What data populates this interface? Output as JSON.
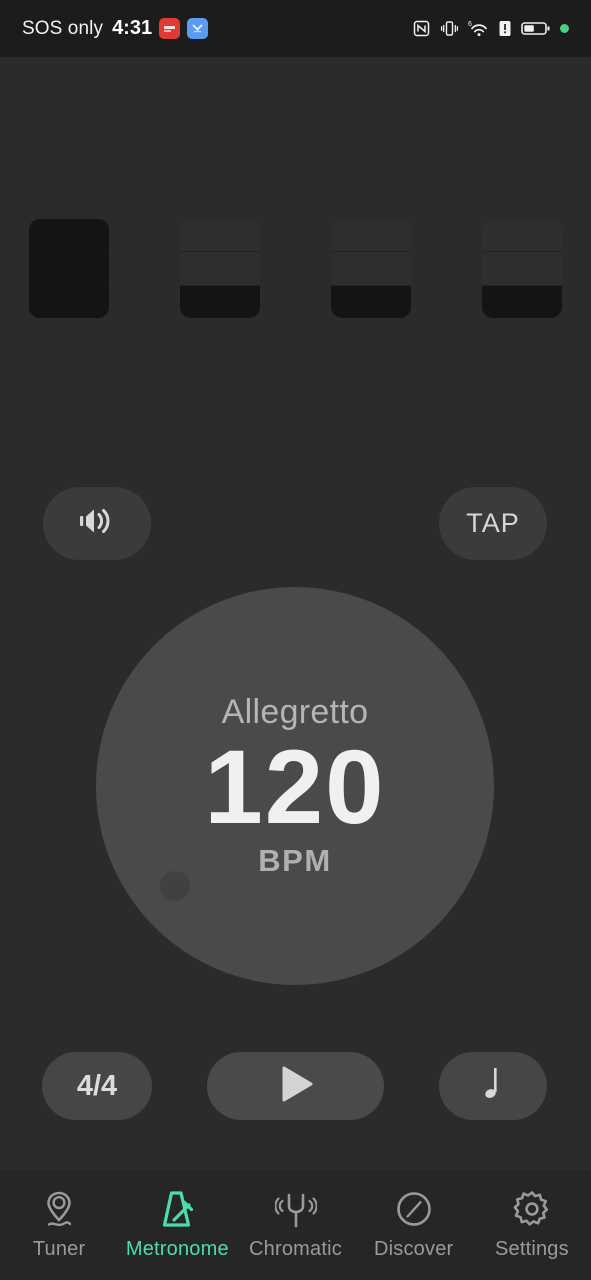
{
  "status_bar": {
    "carrier": "SOS only",
    "time": "4:31",
    "notification_icons": [
      {
        "name": "red-app-notification-icon",
        "color": "#e03a33"
      },
      {
        "name": "blue-app-notification-icon",
        "color": "#5b9bf0"
      }
    ],
    "system_icons": [
      {
        "name": "nfc-icon"
      },
      {
        "name": "vibrate-icon"
      },
      {
        "name": "wifi-icon",
        "badge": "6"
      },
      {
        "name": "sim-alert-icon"
      },
      {
        "name": "battery-icon"
      },
      {
        "name": "green-status-dot-icon",
        "color": "#4cd07d"
      }
    ]
  },
  "beats": {
    "count": 4,
    "segments_per_beat": 3,
    "items": [
      {
        "index": 1,
        "accent": true,
        "filled_segments": 3
      },
      {
        "index": 2,
        "accent": false,
        "filled_segments": 1
      },
      {
        "index": 3,
        "accent": false,
        "filled_segments": 1
      },
      {
        "index": 4,
        "accent": false,
        "filled_segments": 1
      }
    ]
  },
  "controls_top": {
    "volume_icon": "volume-speaker-icon",
    "tap_label": "TAP"
  },
  "dial": {
    "tempo_name": "Allegretto",
    "bpm": "120",
    "unit": "BPM",
    "knob_icon": "dial-knob-handle"
  },
  "controls_bottom": {
    "time_signature": "4/4",
    "play_icon": "play-triangle-icon",
    "note_value_icon": "quarter-note-icon"
  },
  "nav": {
    "active_color": "#4ddbb0",
    "inactive_color": "#9a9a9a",
    "items": [
      {
        "label": "Tuner",
        "icon": "tuner-pin-icon",
        "active": false
      },
      {
        "label": "Metronome",
        "icon": "metronome-icon",
        "active": true
      },
      {
        "label": "Chromatic",
        "icon": "tuning-fork-icon",
        "active": false
      },
      {
        "label": "Discover",
        "icon": "compass-icon",
        "active": false
      },
      {
        "label": "Settings",
        "icon": "gear-icon",
        "active": false
      }
    ]
  }
}
